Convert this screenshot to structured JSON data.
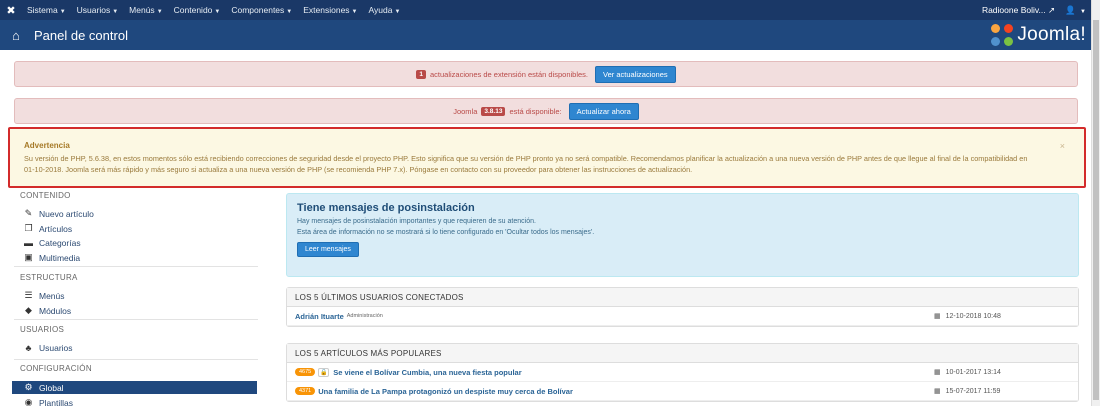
{
  "topbar": {
    "logo_icon": "joomla-icon",
    "menus": [
      "Sistema",
      "Usuarios",
      "Menús",
      "Contenido",
      "Componentes",
      "Extensiones",
      "Ayuda"
    ],
    "site_name": "Radioone Boliv...",
    "external_icon": "external-link-icon",
    "user_icon": "user-icon"
  },
  "header": {
    "title": "Panel de control",
    "home_icon": "home-icon",
    "brand": "Joomla!"
  },
  "alerts": {
    "extensions": {
      "count": "1",
      "text": "actualizaciones de extensión están disponibles.",
      "button": "Ver actualizaciones"
    },
    "joomla": {
      "prefix": "Joomla",
      "version": "3.8.13",
      "suffix": "está disponible:",
      "button": "Actualizar ahora"
    }
  },
  "warning": {
    "title": "Advertencia",
    "text1": "Su versión de PHP, 5.6.38, en estos momentos sólo está recibiendo correcciones de seguridad desde el proyecto PHP. Esto significa que su versión de PHP pronto ya no será compatible. Recomendamos planificar la actualización a una nueva versión de PHP antes de que llegue al final de la compatibilidad en",
    "text2": "01-10-2018. Joomla será más rápido y más seguro si actualiza a una nueva versión de PHP (se recomienda PHP 7.x). Póngase en contacto con su proveedor para obtener las instrucciones de actualización.",
    "close": "×"
  },
  "sidebar": {
    "contenido": "CONTENIDO",
    "nuevo_articulo": "Nuevo artículo",
    "articulos": "Artículos",
    "categorias": "Categorías",
    "multimedia": "Multimedia",
    "estructura": "ESTRUCTURA",
    "menus": "Menús",
    "modulos": "Módulos",
    "usuarios_sec": "USUARIOS",
    "usuarios": "Usuarios",
    "configuracion": "CONFIGURACIÓN",
    "global": "Global",
    "plantillas": "Plantillas"
  },
  "postinstall": {
    "title": "Tiene mensajes de posinstalación",
    "line1": "Hay mensajes de posinstalación importantes y que requieren de su atención.",
    "line2": "Esta área de información no se mostrará si lo tiene configurado en 'Ocultar todos los mensajes'.",
    "button": "Leer mensajes"
  },
  "logged_users": {
    "heading": "LOS 5 ÚLTIMOS USUARIOS CONECTADOS",
    "rows": [
      {
        "name": "Adrián Ituarte",
        "role": "Administración",
        "date": "12-10-2018 10:48"
      }
    ]
  },
  "popular": {
    "heading": "LOS 5 ARTÍCULOS MÁS POPULARES",
    "rows": [
      {
        "hits": "4675",
        "title": "Se viene el Bolívar Cumbia, una nueva fiesta popular",
        "date": "10-01-2017 13:14"
      },
      {
        "hits": "4371",
        "title": "Una familia de La Pampa protagonizó un despiste muy cerca de Bolívar",
        "date": "15-07-2017 11:59"
      }
    ]
  },
  "colors": {
    "topbar": "#1a3867",
    "header": "#1f487e",
    "accent_button": "#2f86d0",
    "alert_red_bg": "#f2dede",
    "warning_bg": "#fcf8e3",
    "warning_border": "#d32b2b",
    "info_bg": "#d9edf7",
    "hits_badge": "#f89406"
  }
}
